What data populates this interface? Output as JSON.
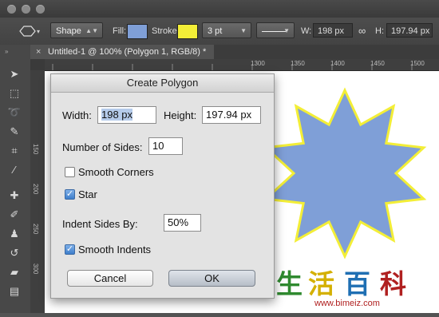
{
  "options_bar": {
    "mode": "Shape",
    "fill_label": "Fill:",
    "fill_color": "#7f9fd7",
    "stroke_label": "Stroke:",
    "stroke_color": "#f3ee37",
    "stroke_width": "3 pt",
    "w_label": "W:",
    "w_value": "198 px",
    "h_label": "H:",
    "h_value": "197.94 px"
  },
  "document_tab": {
    "title": "Untitled-1 @ 100% (Polygon 1, RGB/8) *",
    "close": "×"
  },
  "rulers": {
    "h_ticks": [
      "1300",
      "1350",
      "1400",
      "1450",
      "1500"
    ],
    "v_ticks": [
      "150",
      "200",
      "250",
      "300"
    ]
  },
  "dialog": {
    "title": "Create Polygon",
    "width_label": "Width:",
    "width_value": "198 px",
    "height_label": "Height:",
    "height_value": "197.94 px",
    "sides_label": "Number of Sides:",
    "sides_value": "10",
    "smooth_corners_label": "Smooth Corners",
    "smooth_corners_checked": false,
    "star_label": "Star",
    "star_checked": true,
    "indent_label": "Indent Sides By:",
    "indent_value": "50%",
    "smooth_indents_label": "Smooth Indents",
    "smooth_indents_checked": true,
    "cancel_label": "Cancel",
    "ok_label": "OK"
  },
  "star_shape": {
    "fill": "#7f9fd7",
    "stroke": "#f3ee37",
    "points": 10
  },
  "watermark": {
    "chars": [
      "生",
      "活",
      "百",
      "科"
    ],
    "url": "www.bimeiz.com"
  }
}
